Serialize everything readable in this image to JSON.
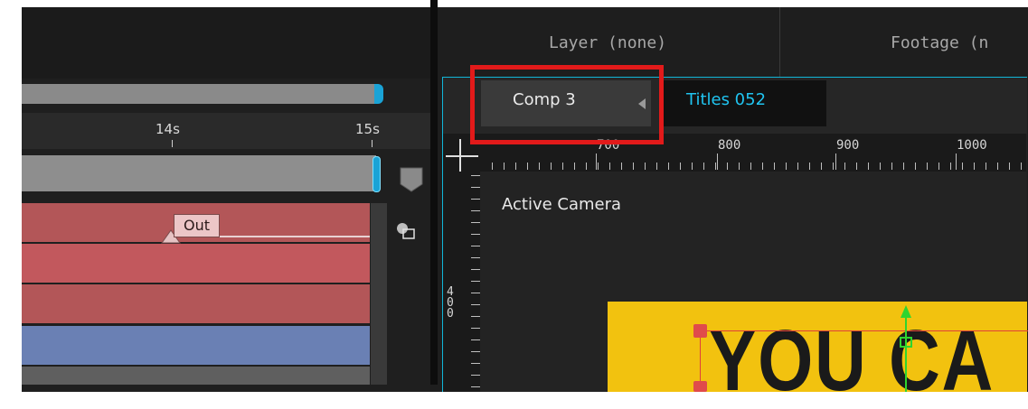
{
  "timeline": {
    "time_ruler": {
      "ticks": [
        "14s",
        "15s"
      ]
    },
    "out_marker_label": "Out"
  },
  "viewer": {
    "tabs": [
      {
        "label": "Layer (none)"
      },
      {
        "label": "Footage (n"
      }
    ],
    "comp_tab_label": "Comp 3",
    "titles_tab_label": "Titles 052",
    "ruler_top_labels": [
      "700",
      "800",
      "900",
      "1000"
    ],
    "ruler_left_label": "400",
    "active_camera_label": "Active Camera",
    "comp_text": "YOU CA"
  },
  "colors": {
    "accent": "#1aa3d6",
    "highlight_box": "#e21a1a",
    "layer_red": "#b35658",
    "layer_blue": "#6a80b4",
    "title_yellow": "#f2c20f"
  }
}
